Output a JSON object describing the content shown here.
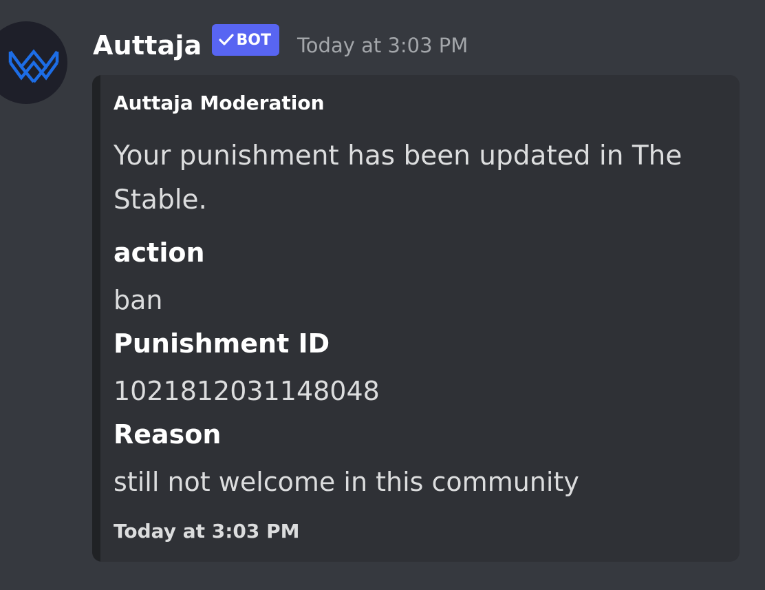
{
  "message": {
    "username": "Auttaja",
    "bot_badge": "BOT",
    "timestamp": "Today at 3:03 PM",
    "avatar_icon": "crown-logo-icon"
  },
  "embed": {
    "author": "Auttaja Moderation",
    "description": "Your punishment has been updated in The Stable.",
    "fields": [
      {
        "name": "action",
        "value": "ban"
      },
      {
        "name": "Punishment ID",
        "value": "1021812031148048"
      },
      {
        "name": "Reason",
        "value": "still not welcome in this community"
      }
    ],
    "footer": "Today at 3:03 PM"
  },
  "colors": {
    "background": "#36393f",
    "embed_background": "#2f3136",
    "embed_bar": "#202225",
    "bot_badge": "#5865f2",
    "avatar_logo": "#1d6de6"
  }
}
